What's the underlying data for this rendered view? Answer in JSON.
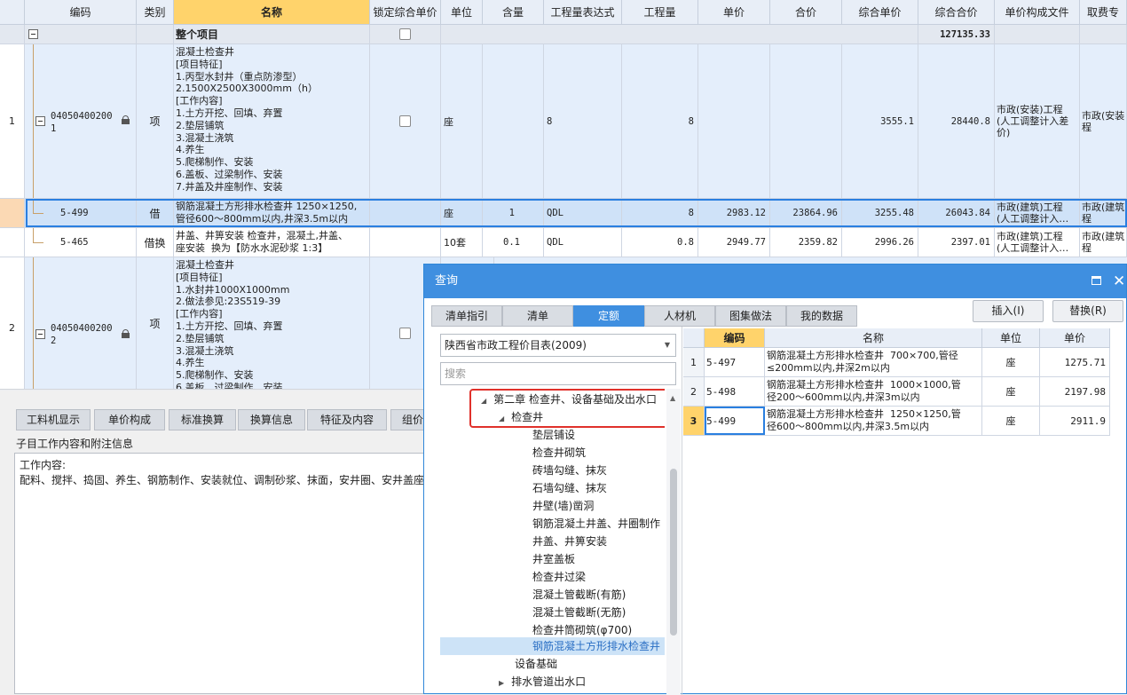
{
  "main_grid": {
    "columns": [
      "编码",
      "类别",
      "名称",
      "锁定综合单价",
      "单位",
      "含量",
      "工程量表达式",
      "工程量",
      "单价",
      "合价",
      "综合单价",
      "综合合价",
      "单价构成文件",
      "取费专"
    ],
    "root": {
      "name": "整个项目",
      "total": "127135.33"
    },
    "rows": [
      {
        "index": "1",
        "code": "04050400200\n1",
        "type": "项",
        "name": "混凝土检查井",
        "features": "[项目特征]\n1.丙型水封井（重点防渗型）\n2.1500X2500X3000mm（h）\n[工作内容]\n1.土方开挖、回填、弃置\n2.垫层铺筑\n3.混凝土浇筑\n4.养生\n5.爬梯制作、安装\n6.盖板、过梁制作、安装\n7.井盖及井座制作、安装",
        "unit": "座",
        "expr": "8",
        "qty": "8",
        "unit_price": "",
        "total_price": "",
        "comp_price": "3555.1",
        "comp_total": "28440.8",
        "file": "市政(安装)工程\n(人工调整计入差\n价)",
        "fee": "市政(安装\n程"
      },
      {
        "index": "",
        "code": "5-499",
        "type": "借",
        "name": "钢筋混凝土方形排水检查井 1250×1250,\n管径600～800mm以内,井深3.5m以内",
        "unit": "座",
        "content": "1",
        "expr": "QDL",
        "qty": "8",
        "unit_price": "2983.12",
        "total_price": "23864.96",
        "comp_price": "3255.48",
        "comp_total": "26043.84",
        "file": "市政(建筑)工程\n(人工调整计入…",
        "fee": "市政(建筑\n程"
      },
      {
        "index": "",
        "code": "5-465",
        "type": "借换",
        "name": "井盖、井箅安装 检查井，混凝土,井盖、\n座安装  换为【防水水泥砂浆 1:3】",
        "unit": "10套",
        "content": "0.1",
        "expr": "QDL",
        "qty": "0.8",
        "unit_price": "2949.77",
        "total_price": "2359.82",
        "comp_price": "2996.26",
        "comp_total": "2397.01",
        "file": "市政(建筑)工程\n(人工调整计入…",
        "fee": "市政(建筑\n程"
      },
      {
        "index": "2",
        "code": "04050400200\n2",
        "type": "项",
        "name": "混凝土检查井",
        "features": "[项目特征]\n1.水封井1000X1000mm\n2.做法参见:23S519-39\n[工作内容]\n1.土方开挖、回填、弃置\n2.垫层铺筑\n3.混凝土浇筑\n4.养生\n5.爬梯制作、安装\n6.盖板、过梁制作、安装"
      }
    ]
  },
  "bottom_panel": {
    "tabs": [
      "工料机显示",
      "单价构成",
      "标准换算",
      "换算信息",
      "特征及内容",
      "组价"
    ],
    "section_title": "子目工作内容和附注信息",
    "content_label": "工作内容:",
    "content_text": "配料、搅拌、捣固、养生、钢筋制作、安装就位、调制砂浆、抹面，安井圈、安井盖座"
  },
  "dialog": {
    "title": "查询",
    "tabs": [
      "清单指引",
      "清单",
      "定额",
      "人材机",
      "图集做法",
      "我的数据"
    ],
    "active_tab": "定额",
    "insert_label": "插入(I)",
    "replace_label": "替换(R)",
    "library": "陕西省市政工程价目表(2009)",
    "search_placeholder": "搜索",
    "tree": [
      {
        "label": "第二章 检查井、设备基础及出水口",
        "expanded": true
      },
      {
        "label": "检查井",
        "expanded": true
      },
      {
        "label": "垫层铺设"
      },
      {
        "label": "检查井砌筑"
      },
      {
        "label": "砖墙勾缝、抹灰"
      },
      {
        "label": "石墙勾缝、抹灰"
      },
      {
        "label": "井壁(墙)凿洞"
      },
      {
        "label": "钢筋混凝土井盖、井圈制作"
      },
      {
        "label": "井盖、井箅安装"
      },
      {
        "label": "井室盖板"
      },
      {
        "label": "检查井过梁"
      },
      {
        "label": "混凝土管截断(有筋)"
      },
      {
        "label": "混凝土管截断(无筋)"
      },
      {
        "label": "检查井筒砌筑(φ700)"
      },
      {
        "label": "钢筋混凝土方形排水检查井",
        "selected": true
      },
      {
        "label": "设备基础"
      },
      {
        "label": "排水管道出水口",
        "collapsed": true
      }
    ],
    "results_columns": [
      "编码",
      "名称",
      "单位",
      "单价"
    ],
    "results": [
      {
        "index": "1",
        "code": "5-497",
        "name": "钢筋混凝土方形排水检查井  700×700,管径\n≤200mm以内,井深2m以内",
        "unit": "座",
        "price": "1275.71"
      },
      {
        "index": "2",
        "code": "5-498",
        "name": "钢筋混凝土方形排水检查井  1000×1000,管\n径200～600mm以内,井深3m以内",
        "unit": "座",
        "price": "2197.98"
      },
      {
        "index": "3",
        "code": "5-499",
        "name": "钢筋混凝土方形排水检查井  1250×1250,管\n径600～800mm以内,井深3.5m以内",
        "unit": "座",
        "price": "2911.9"
      }
    ]
  },
  "colors": {
    "accent": "#3f8fe0",
    "header_active": "#ffd36b",
    "row_selected": "#cfe2f8",
    "highlight_box": "#e0312b"
  }
}
